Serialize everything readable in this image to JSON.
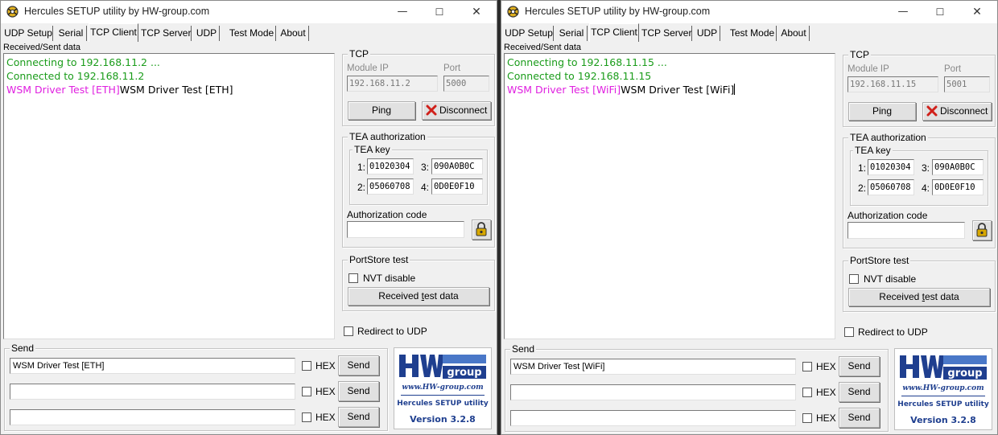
{
  "windows": [
    {
      "title": "Hercules SETUP utility by HW-group.com",
      "tabs": [
        "UDP Setup",
        "Serial",
        "TCP Client",
        "TCP Server",
        "UDP",
        "Test Mode",
        "About"
      ],
      "active_tab": "TCP Client",
      "received_label": "Received/Sent data",
      "received": {
        "line1": "Connecting to 192.168.11.2 ...",
        "line2": "Connected to 192.168.11.2",
        "line3_sent": "WSM Driver Test [ETH]",
        "line3_recv": "WSM Driver Test [ETH]"
      },
      "tcp": {
        "group_label": "TCP",
        "module_ip_label": "Module IP",
        "module_ip": "192.168.11.2",
        "port_label": "Port",
        "port": "5000",
        "ping_label": "Ping",
        "disconnect_label": "Disconnect"
      },
      "tea": {
        "group_label": "TEA authorization",
        "key_label": "TEA key",
        "n1": "1:",
        "k1": "01020304",
        "n2": "2:",
        "k2": "05060708",
        "n3": "3:",
        "k3": "090A0B0C",
        "n4": "4:",
        "k4": "0D0E0F10",
        "auth_code_label": "Authorization code",
        "auth_code": ""
      },
      "portstore": {
        "group_label": "PortStore test",
        "nvt_label": "NVT disable",
        "received_test_pre": "Received ",
        "received_test_ul": "t",
        "received_test_post": "est data"
      },
      "redirect_label": "Redirect to UDP",
      "send": {
        "group_label": "Send",
        "row1": "WSM Driver Test [ETH]",
        "row2": "",
        "row3": "",
        "hex_label": "HEX",
        "send_label": "Send"
      },
      "logo": {
        "url": "www.HW-group.com",
        "product": "Hercules SETUP utility",
        "version": "Version  3.2.8"
      }
    },
    {
      "title": "Hercules SETUP utility by HW-group.com",
      "tabs": [
        "UDP Setup",
        "Serial",
        "TCP Client",
        "TCP Server",
        "UDP",
        "Test Mode",
        "About"
      ],
      "active_tab": "TCP Client",
      "received_label": "Received/Sent data",
      "received": {
        "line1": "Connecting to 192.168.11.15 ...",
        "line2": "Connected to 192.168.11.15",
        "line3_sent": "WSM Driver Test [WiFi]",
        "line3_recv": "WSM Driver Test [WiFi]"
      },
      "tcp": {
        "group_label": "TCP",
        "module_ip_label": "Module IP",
        "module_ip": "192.168.11.15",
        "port_label": "Port",
        "port": "5001",
        "ping_label": "Ping",
        "disconnect_label": "Disconnect"
      },
      "tea": {
        "group_label": "TEA authorization",
        "key_label": "TEA key",
        "n1": "1:",
        "k1": "01020304",
        "n2": "2:",
        "k2": "05060708",
        "n3": "3:",
        "k3": "090A0B0C",
        "n4": "4:",
        "k4": "0D0E0F10",
        "auth_code_label": "Authorization code",
        "auth_code": ""
      },
      "portstore": {
        "group_label": "PortStore test",
        "nvt_label": "NVT disable",
        "received_test_pre": "Received ",
        "received_test_ul": "t",
        "received_test_post": "est data"
      },
      "redirect_label": "Redirect to UDP",
      "send": {
        "group_label": "Send",
        "row1": "WSM Driver Test [WiFi]",
        "row2": "",
        "row3": "",
        "hex_label": "HEX",
        "send_label": "Send"
      },
      "logo": {
        "url": "www.HW-group.com",
        "product": "Hercules SETUP utility",
        "version": "Version  3.2.8"
      }
    }
  ],
  "colors": {
    "connected_text": "#1a9c1a",
    "sent_text": "#e020e0",
    "disconnect_x": "#d0201a",
    "logo_blue": "#1f3f8f"
  },
  "icons": [
    "app-icon",
    "minimize-icon",
    "maximize-icon",
    "close-icon",
    "disconnect-x-icon",
    "lock-icon",
    "hw-group-logo"
  ]
}
